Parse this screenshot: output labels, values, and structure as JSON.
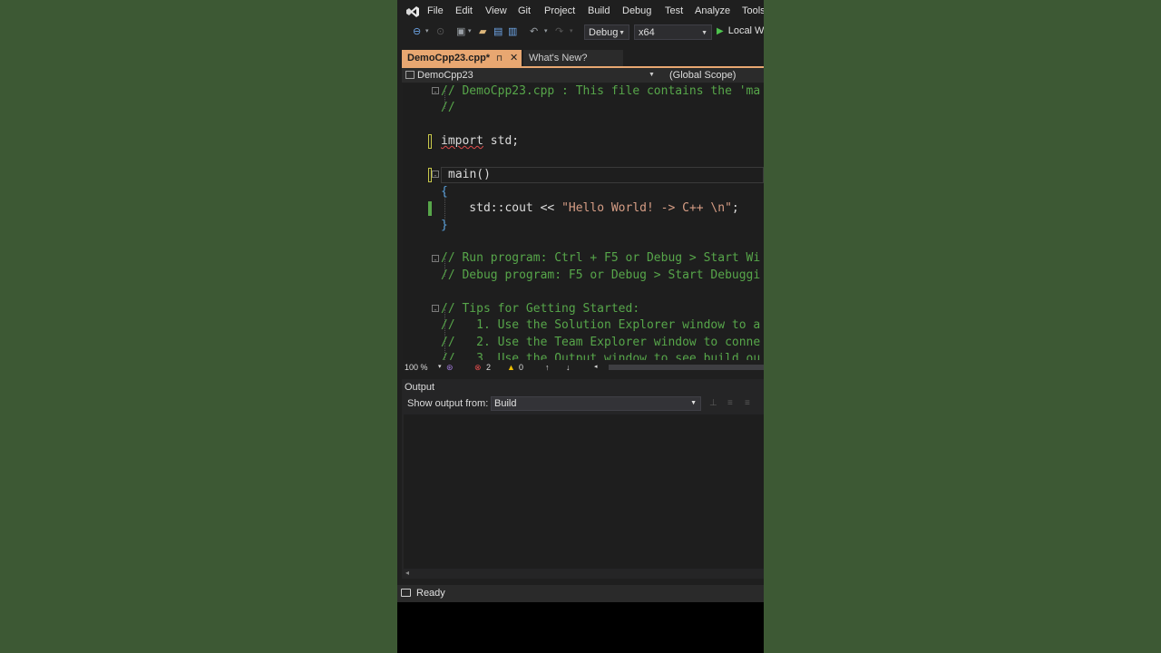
{
  "menu": {
    "items": [
      "File",
      "Edit",
      "View",
      "Git",
      "Project",
      "Build",
      "Debug",
      "Test",
      "Analyze",
      "Tools"
    ]
  },
  "toolbar": {
    "configuration": "Debug",
    "platform": "x64",
    "run_label": "Local W"
  },
  "tabs": {
    "active_label": "DemoCpp23.cpp*",
    "pin_icon": "pin-icon",
    "close_icon": "close-icon",
    "other_label": "What's New?"
  },
  "navbar": {
    "project": "DemoCpp23",
    "scope": "(Global Scope)"
  },
  "editor": {
    "lines": [
      "// DemoCpp23.cpp : This file contains the 'ma",
      "//",
      "",
      "import std;",
      "",
      "main()",
      "{",
      "    std::cout << \"Hello World! -> C++ \\n\";",
      "}",
      "",
      "// Run program: Ctrl + F5 or Debug > Start Wi",
      "// Debug program: F5 or Debug > Start Debuggi",
      "",
      "// Tips for Getting Started:",
      "//   1. Use the Solution Explorer window to a",
      "//   2. Use the Team Explorer window to conne",
      "//   3. Use the Output window to see build ou"
    ],
    "import_kw": "import",
    "import_rest": " std;",
    "main_kw": "main()",
    "cout_code": "    std::cout << ",
    "cout_string": "\"Hello World! -> C++ \\n\"",
    "cout_end": ";"
  },
  "editor_status": {
    "zoom": "100 %",
    "errors": "2",
    "warnings": "0"
  },
  "output": {
    "title": "Output",
    "show_from_label": "Show output from:",
    "show_from_value": "Build"
  },
  "statusbar": {
    "text": "Ready"
  },
  "colors": {
    "active_tab": "#e8a771",
    "comment": "#57a64a",
    "background_green": "#3d5934"
  }
}
